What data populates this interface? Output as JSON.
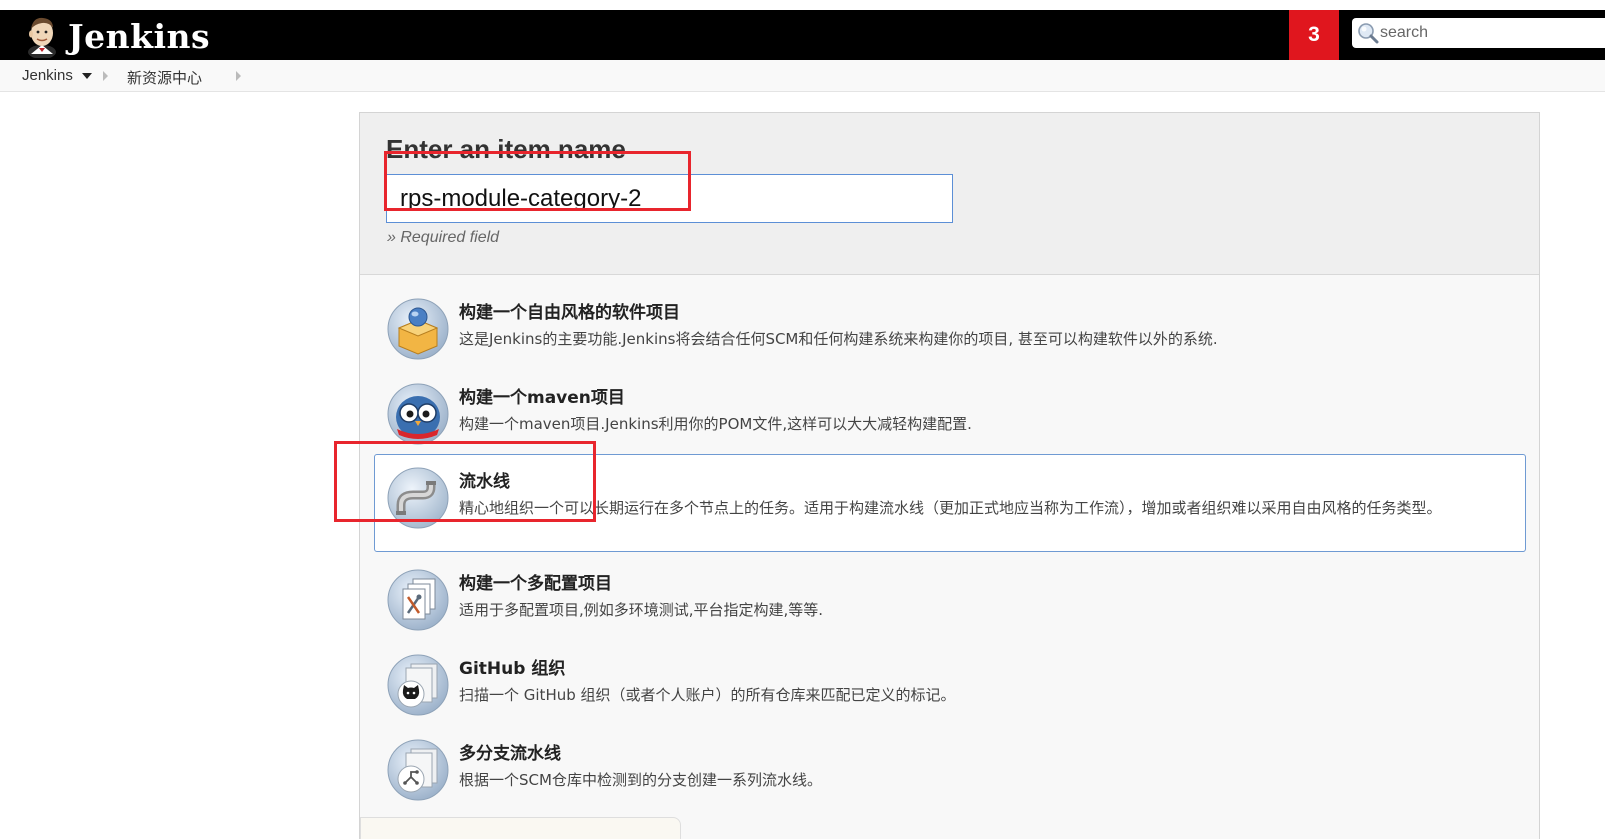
{
  "header": {
    "app_title": "Jenkins",
    "notification_count": "3",
    "search": {
      "placeholder": "search",
      "value": ""
    }
  },
  "breadcrumb": {
    "items": [
      {
        "label": "Jenkins"
      },
      {
        "label": "新资源中心"
      }
    ]
  },
  "new_item": {
    "heading": "Enter an item name",
    "item_name_value": "rps-module-category-2",
    "required_note": "» Required field"
  },
  "job_types": [
    {
      "title": "构建一个自由风格的软件项目",
      "description": "这是Jenkins的主要功能.Jenkins将会结合任何SCM和任何构建系统来构建你的项目, 甚至可以构建软件以外的系统.",
      "icon": "freestyle-project-icon",
      "selected": false
    },
    {
      "title": "构建一个maven项目",
      "description": "构建一个maven项目.Jenkins利用你的POM文件,这样可以大大减轻构建配置.",
      "icon": "maven-project-icon",
      "selected": false
    },
    {
      "title": "流水线",
      "description": "精心地组织一个可以长期运行在多个节点上的任务。适用于构建流水线（更加正式地应当称为工作流），增加或者组织难以采用自由风格的任务类型。",
      "icon": "pipeline-icon",
      "selected": true
    },
    {
      "title": "构建一个多配置项目",
      "description": "适用于多配置项目,例如多环境测试,平台指定构建,等等.",
      "icon": "multi-configuration-icon",
      "selected": false
    },
    {
      "title": "GitHub 组织",
      "description": "扫描一个 GitHub 组织（或者个人账户）的所有仓库来匹配已定义的标记。",
      "icon": "github-organization-icon",
      "selected": false
    },
    {
      "title": "多分支流水线",
      "description": "根据一个SCM仓库中检测到的分支创建一系列流水线。",
      "icon": "multibranch-pipeline-icon",
      "selected": false
    }
  ],
  "colors": {
    "header_bg": "#000000",
    "badge_red": "#e0161e",
    "annotation_red": "#e8252d",
    "selection_border": "#6f9ad3",
    "input_border": "#5c8fd6"
  }
}
